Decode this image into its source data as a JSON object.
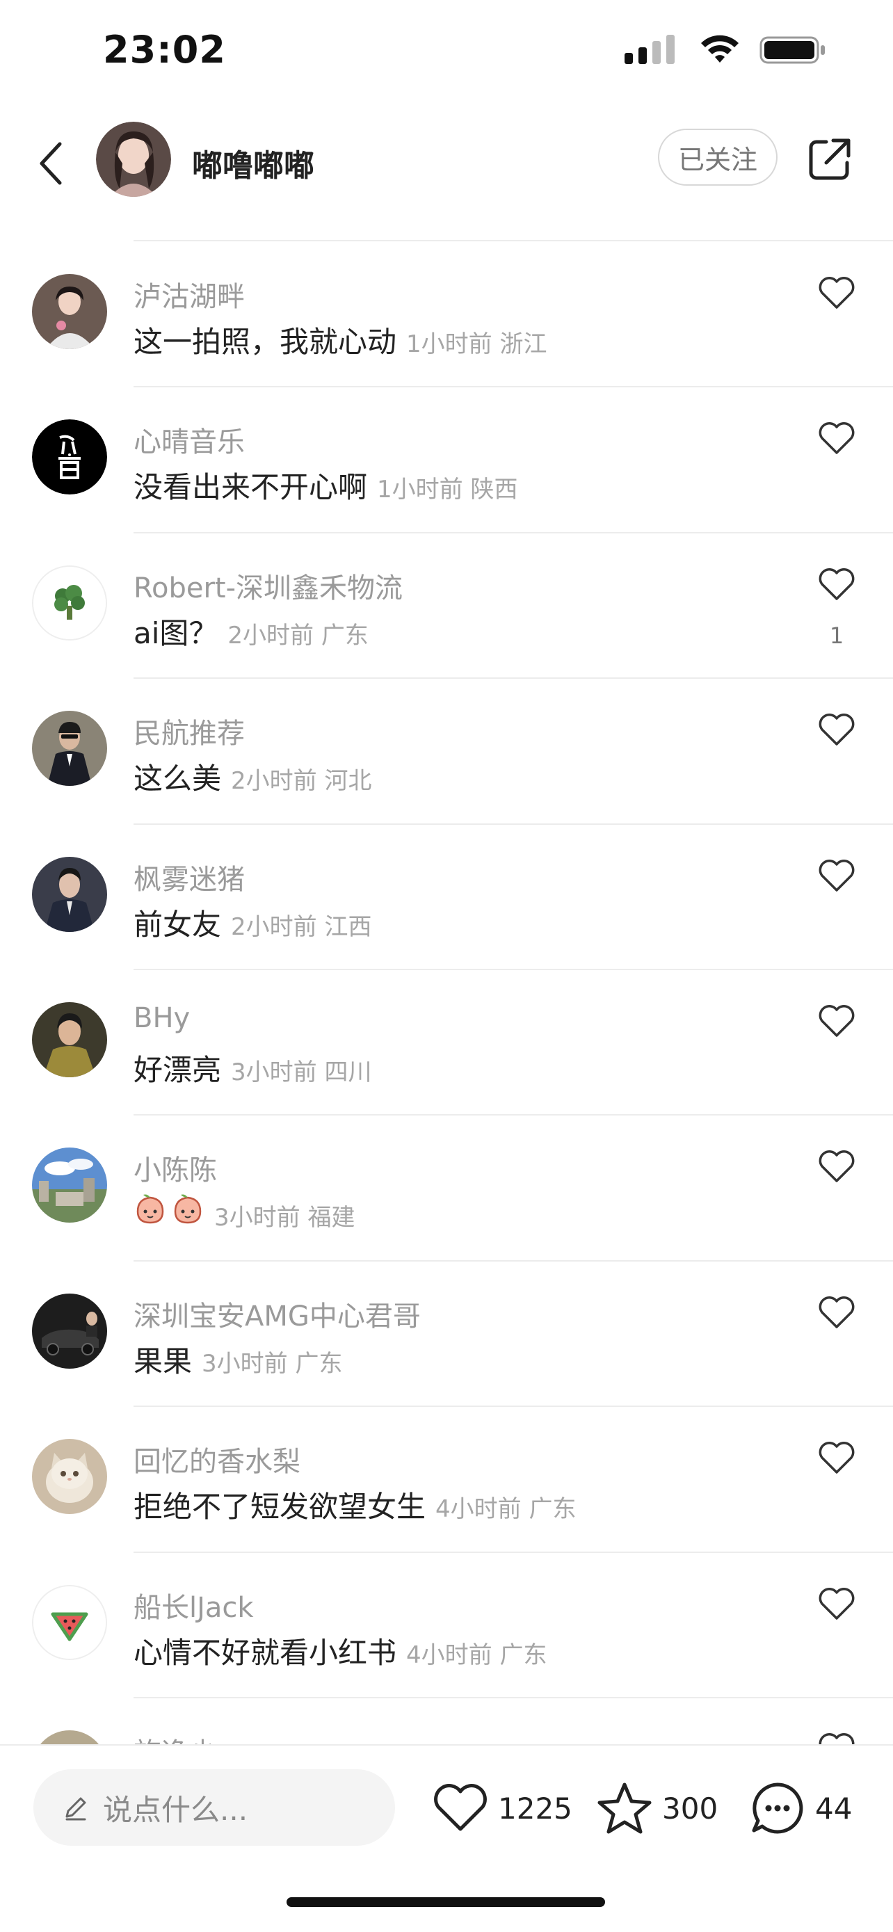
{
  "status_bar": {
    "time": "23:02"
  },
  "header": {
    "author_name": "嘟噜嘟嘟",
    "follow_label": "已关注"
  },
  "comments": [
    {
      "nick": "泸沽湖畔",
      "text": "这一拍照，我就心动",
      "meta": "1小时前 浙江",
      "likes": "",
      "avatar_color": "#6b5a52"
    },
    {
      "nick": "心晴音乐",
      "text": "没看出来不开心啊",
      "meta": "1小时前 陕西",
      "likes": "",
      "avatar_color": "#000000"
    },
    {
      "nick": "Robert-深圳鑫禾物流",
      "text": "ai图？",
      "meta": "2小时前 广东",
      "likes": "1",
      "avatar_color": "#ffffff"
    },
    {
      "nick": "民航推荐",
      "text": "这么美",
      "meta": "2小时前 河北",
      "likes": "",
      "avatar_color": "#3b3b3b"
    },
    {
      "nick": "枫雾迷猪",
      "text": "前女友",
      "meta": "2小时前 江西",
      "likes": "",
      "avatar_color": "#2e3140"
    },
    {
      "nick": "BHy",
      "text": "好漂亮",
      "meta": "3小时前 四川",
      "likes": "",
      "avatar_color": "#5e5a3c"
    },
    {
      "nick": "小陈陈",
      "text": "",
      "meta": "3小时前 福建",
      "likes": "",
      "avatar_color": "#4a7ab5",
      "emoji_count": 2
    },
    {
      "nick": "深圳宝安AMG中心君哥",
      "text": "果果",
      "meta": "3小时前 广东",
      "likes": "",
      "avatar_color": "#1d1d1d"
    },
    {
      "nick": "回忆的香水梨",
      "text": "拒绝不了短发欲望女生",
      "meta": "4小时前 广东",
      "likes": "",
      "avatar_color": "#c9b7a0"
    },
    {
      "nick": "船长lJack",
      "text": "心情不好就看小红书",
      "meta": "4小时前 广东",
      "likes": "",
      "avatar_color": "#ffffff"
    },
    {
      "nick": "旅逸少",
      "text": "",
      "meta": "",
      "likes": "",
      "avatar_color": "#b5a98f"
    }
  ],
  "bottom_bar": {
    "input_placeholder": "说点什么...",
    "like_count": "1225",
    "collect_count": "300",
    "comment_count": "44"
  },
  "icons": {
    "back": "chevron-left-icon",
    "share": "share-icon",
    "like": "heart-icon",
    "collect": "star-icon",
    "comment": "chat-bubble-icon",
    "edit": "pencil-icon"
  }
}
